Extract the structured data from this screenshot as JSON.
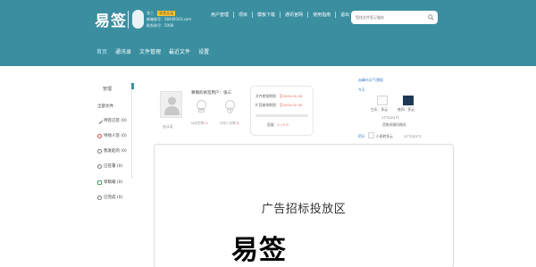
{
  "header": {
    "logo": "易签",
    "user": {
      "name": "张三",
      "name_badge": "实名认证",
      "email_label": "邮箱账号：",
      "email": "58449163.com",
      "phone_label": "联系账号：",
      "phone": "5008"
    },
    "top_nav": [
      "用户管理",
      "项目",
      "模板下载",
      "通讯官网",
      "使用指南",
      "退出"
    ],
    "search": {
      "placeholder": "您找文件签订服务"
    },
    "main_nav": [
      "首页",
      "通讯录",
      "文件管理",
      "最近文件",
      "设置"
    ],
    "main_nav_active": 0
  },
  "sidebar": {
    "title": "管理",
    "items": [
      {
        "label": "全部文件",
        "icon": "none"
      },
      {
        "label": "待签已签 (0)",
        "icon": "pen-icon"
      },
      {
        "label": "待他人签 (0)",
        "icon": "clock-icon"
      },
      {
        "label": "我发起的 (0)",
        "icon": "user-icon"
      },
      {
        "label": "已签署 (0)",
        "icon": "check-circle-icon"
      },
      {
        "label": "草稿箱 (0)",
        "icon": "draft-icon"
      },
      {
        "label": "已完成 (0)",
        "icon": "done-icon"
      }
    ]
  },
  "profile": {
    "welcome": "尊敬的易签用户：张三",
    "cert_link": "去认证",
    "btn1_label": "待我签署",
    "btn1_count": "0",
    "btn2_label": "待他人签署",
    "btn2_count": "0"
  },
  "info": {
    "line1_label": "文件套餐期限：",
    "line1_value": "至0000-00-00",
    "line2_label": "扩容套餐期限：",
    "line2_value": "至0000-00-00",
    "usage_label": "容量：",
    "usage_value": "0 / 0 G",
    "usage_fraction": 0
  },
  "weather": {
    "title": "赤峰市天气预报",
    "today_label": "今天",
    "today_day": "白天：多云",
    "today_night": "夜间：多云",
    "temp": "17°C/21°C",
    "wind": "西南风微风微风",
    "tomorrow_label": "明天",
    "tomorrow_desc": "小雨转多云",
    "tomorrow_temp": "17°C/21°C"
  },
  "ad": {
    "text": "广告招标投放区"
  },
  "watermark": "易签",
  "colors": {
    "header": "#3a8ea0",
    "accent_red": "#e26a5e",
    "weather_blue": "#3b7fc3"
  }
}
